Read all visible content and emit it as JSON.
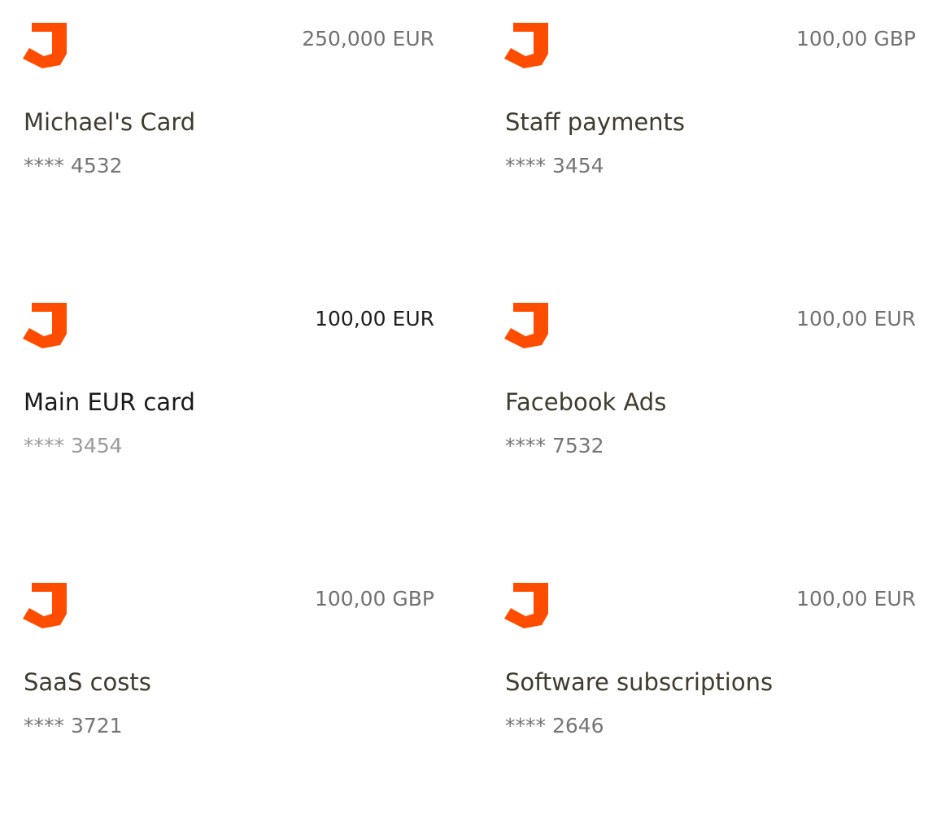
{
  "brand": {
    "accent": "#ff4d00",
    "logo_icon": "j-shield-logo-icon"
  },
  "cards": [
    {
      "amount": "250,000 EUR",
      "name": "Michael's Card",
      "number": "**** 4532"
    },
    {
      "amount": "100,00 GBP",
      "name": "Staff payments",
      "number": "**** 3454"
    },
    {
      "amount": "100,00 EUR",
      "name": "Main EUR card",
      "number": "**** 3454"
    },
    {
      "amount": "100,00 EUR",
      "name": "Facebook Ads",
      "number": "**** 7532"
    },
    {
      "amount": "100,00 GBP",
      "name": "SaaS costs",
      "number": "**** 3721"
    },
    {
      "amount": "100,00 EUR",
      "name": "Software subscriptions",
      "number": "**** 2646"
    }
  ]
}
